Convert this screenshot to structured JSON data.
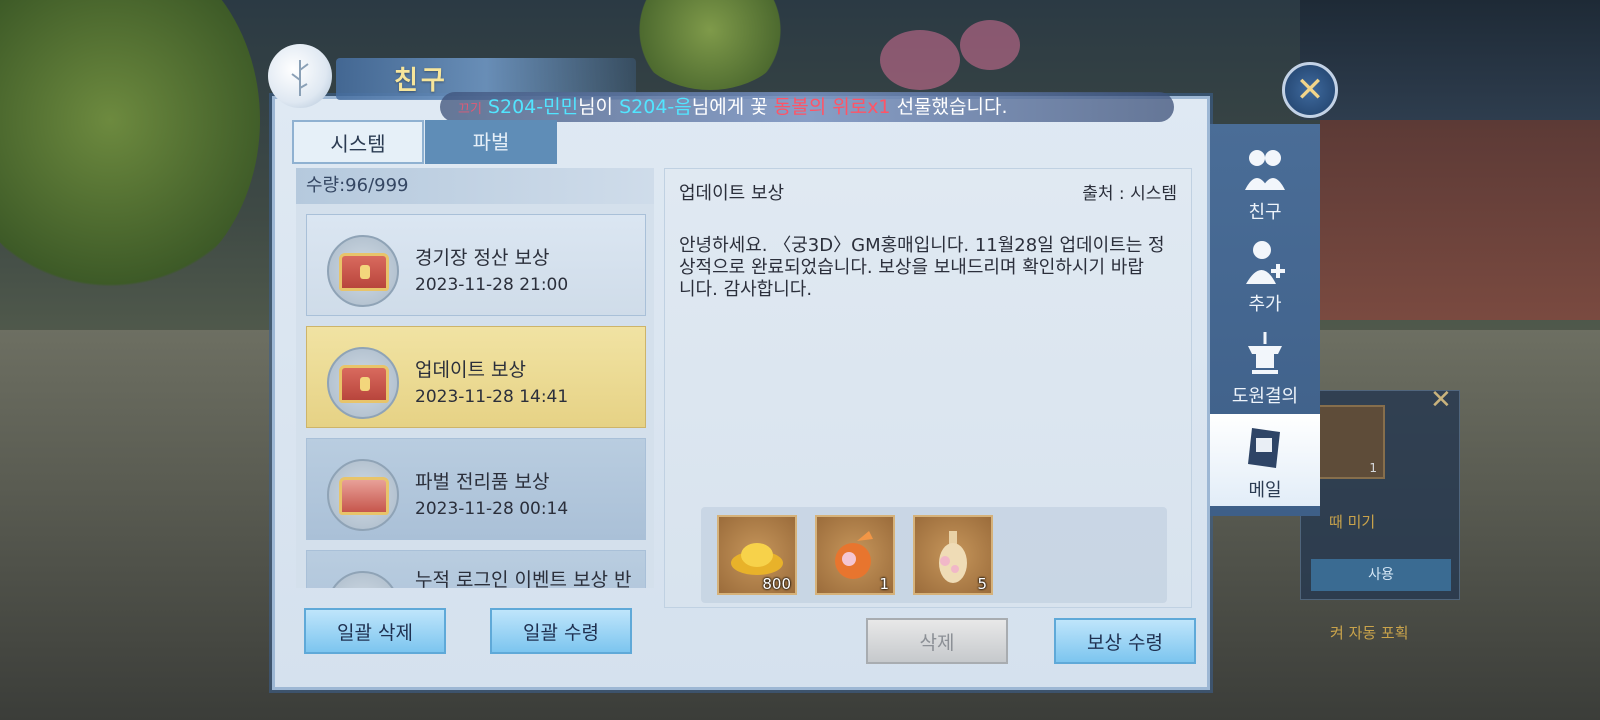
{
  "window": {
    "title": "친구"
  },
  "banner": {
    "tag": "끄기",
    "sender": "S204-민민",
    "text1": "님이 ",
    "receiver": "S204-음",
    "text2": "님에게 꽃 ",
    "item": "동볼의 위로x1",
    "text3": " 선물했습니다."
  },
  "tabs": [
    {
      "label": "시스템",
      "active": true
    },
    {
      "label": "파벌",
      "active": false
    }
  ],
  "list": {
    "count_label": "수량:96/999",
    "items": [
      {
        "title": "경기장 정산 보상",
        "date": "2023-11-28 21:00"
      },
      {
        "title": "업데이트 보상",
        "date": "2023-11-28 14:41"
      },
      {
        "title": "파벌 전리품 보상",
        "date": "2023-11-28 00:14"
      },
      {
        "title": "누적 로그인 이벤트 보상 반환"
      }
    ]
  },
  "buttons": {
    "bulk_delete": "일괄 삭제",
    "bulk_receive": "일괄 수령",
    "delete": "삭제",
    "receive": "보상 수령"
  },
  "detail": {
    "title": "업데이트 보상",
    "source": "출처 : 시스템",
    "body_lines": [
      "안녕하세요. 〈궁3D〉GM홍매입니다. 11월28일 업데이트는 정",
      "상적으로 완료되었습니다. 보상을 보내드리며 확인하시기 바랍",
      "니다. 감사합니다."
    ],
    "rewards": [
      {
        "icon": "gold-ingot-icon",
        "count": "800"
      },
      {
        "icon": "flower-pouch-icon",
        "count": "1"
      },
      {
        "icon": "blossom-vase-icon",
        "count": "5"
      }
    ]
  },
  "nav": [
    {
      "label": "친구",
      "icon": "friends-icon",
      "active": false
    },
    {
      "label": "추가",
      "icon": "add-friend-icon",
      "active": false
    },
    {
      "label": "도원결의",
      "icon": "oath-altar-icon",
      "active": false
    },
    {
      "label": "메일",
      "icon": "mail-book-icon",
      "active": true
    }
  ],
  "background_panel": {
    "item_count": "1",
    "label": "때 미기",
    "use": "사용",
    "auto": "켜 자동 포획"
  },
  "colors": {
    "accent_gold": "#f6e59b",
    "banner_player": "#52e5ff",
    "banner_item": "#ff5466",
    "selected_item": "#f1e3a3",
    "button_blue": "#7cc5ef"
  }
}
